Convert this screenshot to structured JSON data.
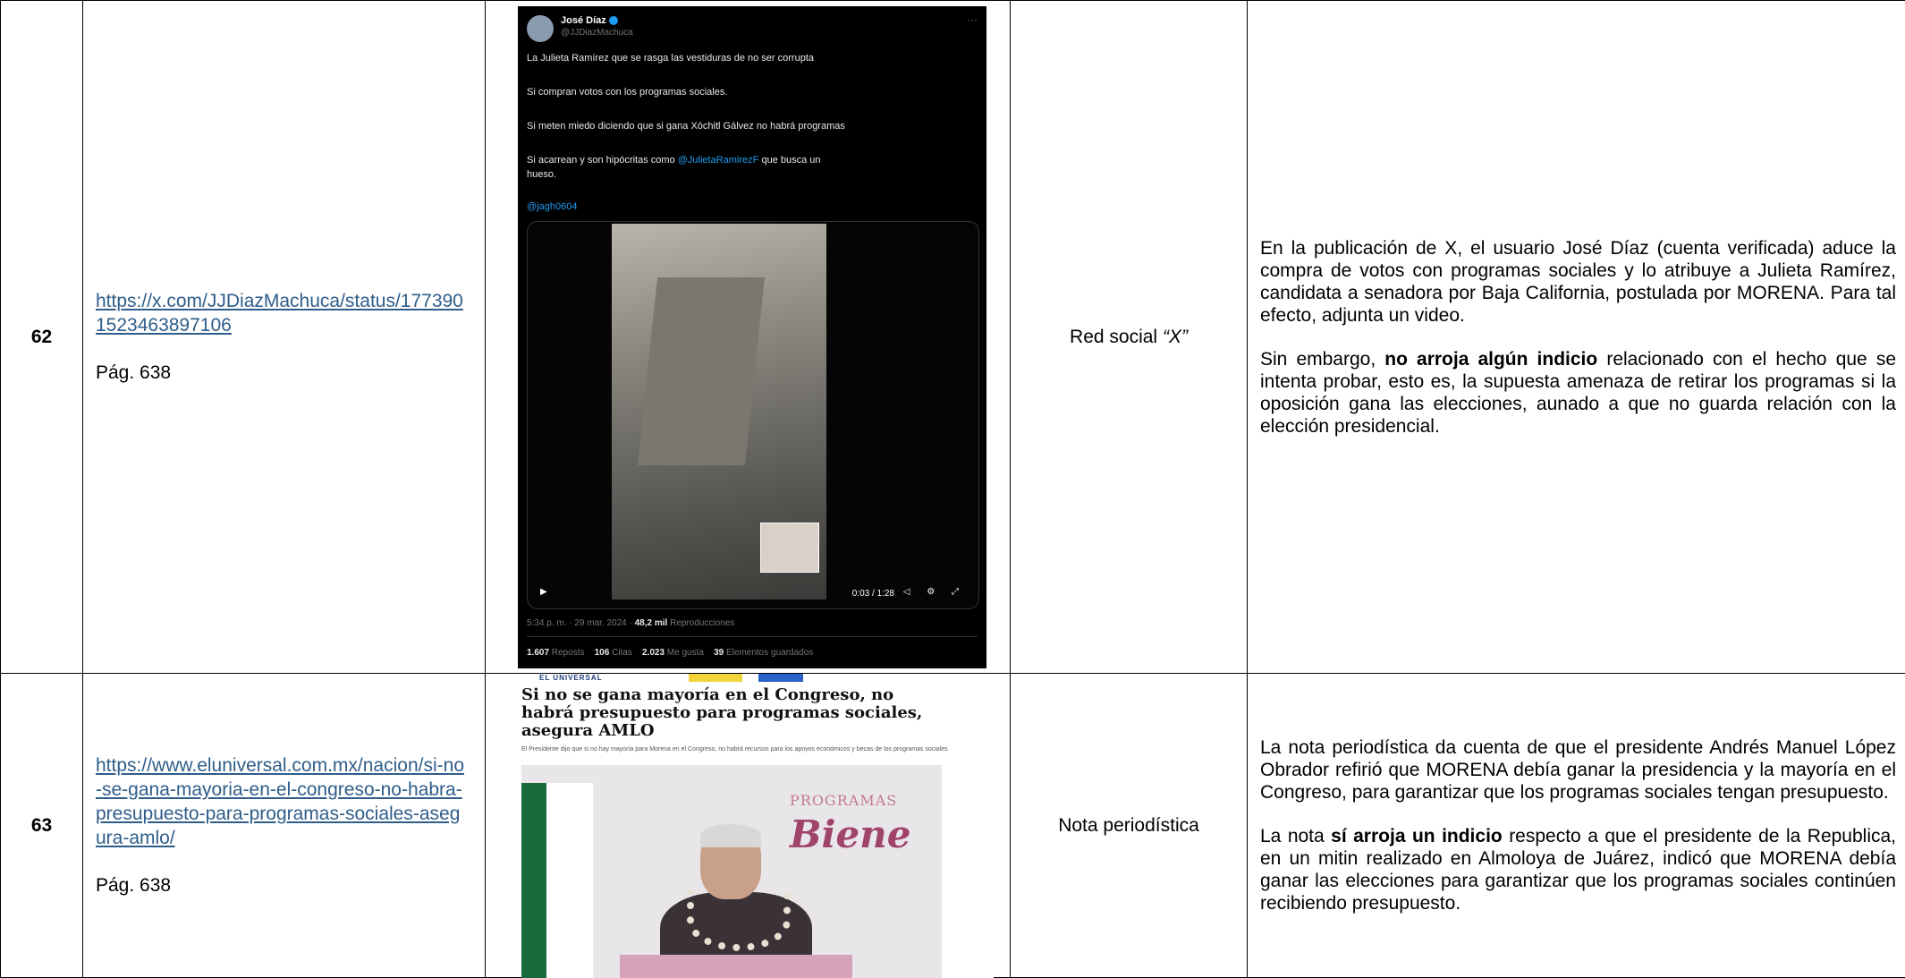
{
  "rows": [
    {
      "number": "62",
      "link": "https://x.com/JJDiazMachuca/status/1773901523463897106",
      "page": "Pág. 638",
      "source_prefix": "Red social ",
      "source_emph": "“X”",
      "tweet": {
        "author": "José Díaz",
        "handle": "@JJDiazMachuca",
        "more": "···",
        "lines": [
          "La Julieta Ramírez que se rasga las vestiduras de no ser corrupta",
          "Si compran votos con los programas sociales.",
          "Si meten miedo diciendo que si gana Xóchitl Gálvez no habrá programas",
          "Si acarrean y son hipócritas como",
          "hueso."
        ],
        "mention": "@JulietaRamirezF",
        "after_mention": " que busca un",
        "hashtag": "@jagh0604",
        "video_time": "0:03 / 1:28",
        "meta_time": "5:34 p. m. · 29 mar. 2024 · ",
        "views": "48,2 mil",
        "views_label": " Reproducciones",
        "reposts": "1.607",
        "reposts_label": " Reposts",
        "quotes": "106",
        "quotes_label": " Citas",
        "likes": "2.023",
        "likes_label": " Me gusta",
        "saves": "39",
        "saves_label": " Elementos guardados"
      },
      "description_p1": "En la publicación de X, el usuario José Díaz (cuenta verificada) aduce la compra de votos con programas sociales y lo atribuye a Julieta Ramírez, candidata a senadora por Baja California, postulada por MORENA. Para tal efecto, adjunta un video.",
      "description_p2_a": "Sin embargo, ",
      "description_p2_bold": "no arroja algún indicio",
      "description_p2_b": " relacionado con el hecho que se intenta probar, esto es, la supuesta amenaza de retirar los programas si la oposición gana las elecciones, aunado a que no guarda relación con la elección presidencial."
    },
    {
      "number": "63",
      "link": "https://www.eluniversal.com.mx/nacion/si-no-se-gana-mayoria-en-el-congreso-no-habra-presupuesto-para-programas-sociales-asegura-amlo/",
      "page": "Pág. 638",
      "source": "Nota periodística",
      "news": {
        "logo": "EL UNIVERSAL",
        "headline": "Si no se gana mayoría en el Congreso, no habrá presupuesto para programas sociales, asegura AMLO",
        "lead": "El Presidente dijo que si no hay mayoría para Morena en el Congreso, no habrá recursos para los apoyos económicos y becas de los programas sociales",
        "banner_1": "PROGRAMAS",
        "banner_2": "Biene"
      },
      "description_p1": "La nota periodística da cuenta de que el presidente Andrés Manuel López Obrador refirió que MORENA debía ganar la presidencia y la mayoría en el Congreso, para garantizar que los programas sociales tengan presupuesto.",
      "description_p2_a": "La nota ",
      "description_p2_bold": "sí arroja un indicio",
      "description_p2_b": " respecto a que el presidente de la Republica, en un mitin realizado en Almoloya de Juárez, indicó que MORENA debía ganar las elecciones para garantizar que los programas sociales continúen recibiendo presupuesto."
    }
  ]
}
